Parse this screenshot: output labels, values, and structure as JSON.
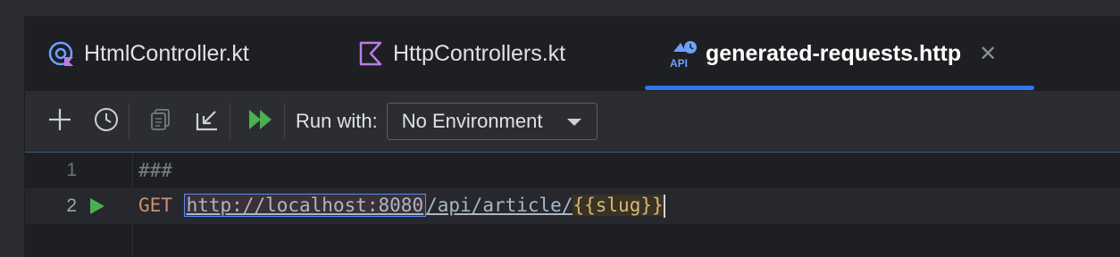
{
  "tabs": [
    {
      "label": "HtmlController.kt",
      "icon": "kotlin-controller-icon",
      "active": false
    },
    {
      "label": "HttpControllers.kt",
      "icon": "kotlin-file-icon",
      "active": false
    },
    {
      "label": "generated-requests.http",
      "icon": "api-http-icon",
      "active": true
    }
  ],
  "toolbar": {
    "run_with_label": "Run with:",
    "environment_value": "No Environment"
  },
  "editor": {
    "lines": [
      {
        "number": "1",
        "text": "###"
      },
      {
        "number": "2",
        "method": "GET",
        "url_host": "http://localhost:8080",
        "url_path": "/api/article/",
        "variable": "{{slug}}"
      }
    ]
  },
  "colors": {
    "accent": "#3574f0",
    "run_green": "#4caf50",
    "background": "#1e1f22",
    "toolbar_bg": "#2b2d30"
  }
}
